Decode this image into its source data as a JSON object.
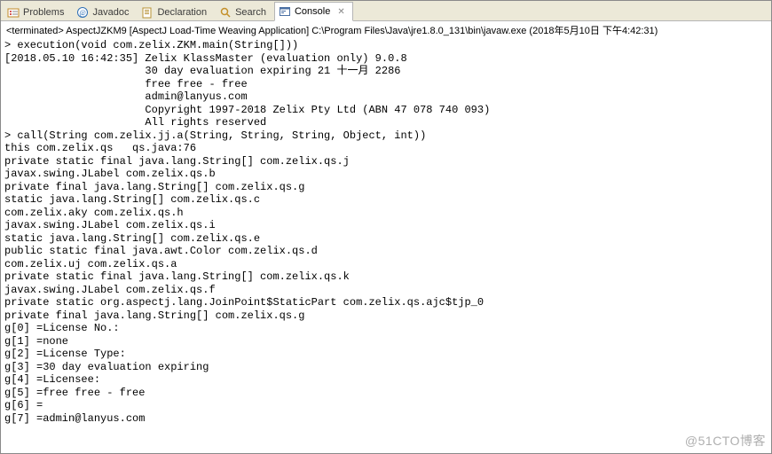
{
  "tabs": [
    {
      "label": "Problems",
      "icon": "problems-icon"
    },
    {
      "label": "Javadoc",
      "icon": "javadoc-icon"
    },
    {
      "label": "Declaration",
      "icon": "declaration-icon"
    },
    {
      "label": "Search",
      "icon": "search-icon"
    },
    {
      "label": "Console",
      "icon": "console-icon"
    }
  ],
  "active_tab_index": 4,
  "close_glyph": "✕",
  "status_line": "<terminated> AspectJZKM9 [AspectJ Load-Time Weaving Application] C:\\Program Files\\Java\\jre1.8.0_131\\bin\\javaw.exe (2018年5月10日 下午4:42:31)",
  "console_lines": [
    "> execution(void com.zelix.ZKM.main(String[]))",
    "[2018.05.10 16:42:35] Zelix KlassMaster (evaluation only) 9.0.8",
    "                      30 day evaluation expiring 21 十一月 2286",
    "                      free free - free",
    "                      admin@lanyus.com",
    "                      Copyright 1997-2018 Zelix Pty Ltd (ABN 47 078 740 093)",
    "                      All rights reserved",
    "> call(String com.zelix.jj.a(String, String, String, Object, int))",
    "this com.zelix.qs   qs.java:76",
    "private static final java.lang.String[] com.zelix.qs.j",
    "javax.swing.JLabel com.zelix.qs.b",
    "private final java.lang.String[] com.zelix.qs.g",
    "static java.lang.String[] com.zelix.qs.c",
    "com.zelix.aky com.zelix.qs.h",
    "javax.swing.JLabel com.zelix.qs.i",
    "static java.lang.String[] com.zelix.qs.e",
    "public static final java.awt.Color com.zelix.qs.d",
    "com.zelix.uj com.zelix.qs.a",
    "private static final java.lang.String[] com.zelix.qs.k",
    "javax.swing.JLabel com.zelix.qs.f",
    "private static org.aspectj.lang.JoinPoint$StaticPart com.zelix.qs.ajc$tjp_0",
    "private final java.lang.String[] com.zelix.qs.g",
    "g[0] =License No.:",
    "g[1] =none",
    "g[2] =License Type:",
    "g[3] =30 day evaluation expiring",
    "g[4] =Licensee:",
    "g[5] =free free - free",
    "g[6] =",
    "g[7] =admin@lanyus.com"
  ],
  "watermark": "@51CTO博客",
  "chart_data": {
    "type": "table",
    "title": "g[] array contents",
    "categories": [
      "g[0]",
      "g[1]",
      "g[2]",
      "g[3]",
      "g[4]",
      "g[5]",
      "g[6]",
      "g[7]"
    ],
    "values": [
      "License No.:",
      "none",
      "License Type:",
      "30 day evaluation expiring",
      "Licensee:",
      "free free - free",
      "",
      "admin@lanyus.com"
    ]
  }
}
